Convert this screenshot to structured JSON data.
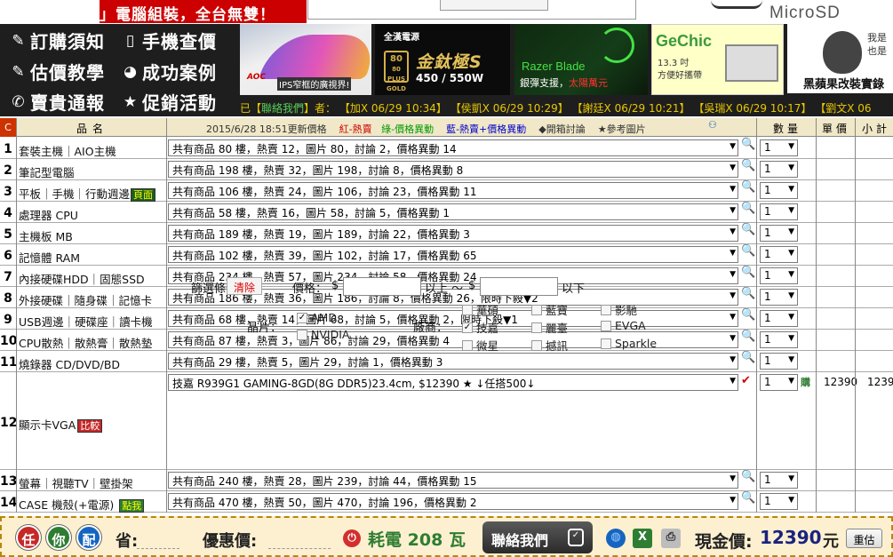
{
  "banner": {
    "slogan": "」電腦組裝，全台無雙！",
    "microsd": "MicroSD"
  },
  "menu": [
    {
      "icon": "wrench-icon",
      "glyph": "✎",
      "label": "訂購須知"
    },
    {
      "icon": "phone-icon",
      "glyph": "▯",
      "label": "手機查價"
    },
    {
      "icon": "edit-icon",
      "glyph": "✎",
      "label": "估價教學"
    },
    {
      "icon": "chat-icon",
      "glyph": "◕",
      "label": "成功案例"
    },
    {
      "icon": "telephone-icon",
      "glyph": "✆",
      "label": "賣貴通報"
    },
    {
      "icon": "star-icon",
      "glyph": "★",
      "label": "促銷活動"
    }
  ],
  "ads": {
    "aoc": {
      "brand": "AOC",
      "caption": "IPS窄框的廣視界!"
    },
    "psu": {
      "brand": "全漢電源",
      "badge": "80 PLUS GOLD",
      "name": "金鈦極S",
      "watt": "450 / 550W"
    },
    "razer": {
      "name": "Razer Blade",
      "sub_a": "銀彈支援，",
      "sub_b": "太陽萬元"
    },
    "gechic": {
      "brand": "GeChic",
      "l1": "13.3 吋",
      "l2": "方便好攜帶"
    },
    "apple": {
      "bubble1": "我是",
      "bubble2": "也是",
      "caption": "黑蘋果改裝實錄"
    }
  },
  "ticker": {
    "lead": "已【",
    "link": "聯絡我們",
    "after": "】者：",
    "items": "【加X 06/29 10:34】 【侯凱X 06/29 10:29】 【謝廷X 06/29 10:21】 【吳瑞X 06/29 10:17】 【劉文X 06"
  },
  "header": {
    "c": "C",
    "product_name": "品名",
    "updated": "2015/6/28 18:51更新價格",
    "legend_red": "紅-熱賣",
    "legend_green": "綠-價格異動",
    "legend_blue": "藍-熱賣+價格異動",
    "legend_discuss": "◆開箱討論",
    "legend_ref": "★參考圖片",
    "qty": "數量",
    "unit": "單價",
    "subtotal": "小計"
  },
  "rows": [
    {
      "n": "1",
      "cat": "套裝主機｜AIO主機",
      "summary": "共有商品 80 樓，熱賣 12，圖片 80，討論 2，價格異動 14",
      "qty": "1"
    },
    {
      "n": "2",
      "cat": "筆記型電腦",
      "summary": "共有商品 198 樓，熱賣 32，圖片 198，討論 8，價格異動 8",
      "qty": "1"
    },
    {
      "n": "3",
      "cat": "平板｜手機｜行動週邊",
      "tag": "頁面",
      "summary": "共有商品 106 樓，熱賣 24，圖片 106，討論 23，價格異動 11",
      "qty": "1"
    },
    {
      "n": "4",
      "cat": "處理器 CPU",
      "summary": "共有商品 58 樓，熱賣 16，圖片 58，討論 5，價格異動 1",
      "qty": "1"
    },
    {
      "n": "5",
      "cat": "主機板 MB",
      "summary": "共有商品 189 樓，熱賣 19，圖片 189，討論 22，價格異動 3",
      "qty": "1"
    },
    {
      "n": "6",
      "cat": "記憶體 RAM",
      "summary": "共有商品 102 樓，熱賣 39，圖片 102，討論 17，價格異動 65",
      "qty": "1"
    },
    {
      "n": "7",
      "cat": "內接硬碟HDD｜固態SSD",
      "summary": "共有商品 234 樓，熱賣 57，圖片 234，討論 58，價格異動 24",
      "qty": "1"
    },
    {
      "n": "8",
      "cat": "外接硬碟｜隨身碟｜記憶卡",
      "summary": "共有商品 186 樓，熱賣 36，圖片 186，討論 8，價格異動 26，限時下殺▼2",
      "qty": "1"
    },
    {
      "n": "9",
      "cat": "USB週邊｜硬碟座｜讀卡機",
      "summary": "共有商品 68 樓，熱賣 14，圖片 68，討論 5，價格異動 2，限時下殺▼1",
      "qty": "1"
    },
    {
      "n": "10",
      "cat": "CPU散熱｜散熱膏｜散熱墊",
      "summary": "共有商品 87 樓，熱賣 3，圖片 86，討論 29，價格異動 4",
      "qty": "1"
    },
    {
      "n": "11",
      "cat": "燒錄器 CD/DVD/BD",
      "summary": "共有商品 29 樓，熱賣 5，圖片 29，討論 1，價格異動 3",
      "qty": "1"
    }
  ],
  "vga": {
    "n": "12",
    "cat": "顯示卡VGA",
    "tag": "比較",
    "selected": "技嘉 R939G1 GAMING-8GD(8G DDR5)23.4cm, $12390 ★ ↓任搭500↓",
    "qty": "1",
    "buy": "購",
    "price": "12390",
    "subtotal": "1239",
    "filter_label": "篩選條件：",
    "clear": "清除",
    "price_label": "價格：",
    "currency": "$",
    "above": "以上 ～",
    "below": "以下",
    "chip_label": "晶片：",
    "chips": [
      {
        "name": "AMD",
        "checked": true
      },
      {
        "name": "NVIDIA",
        "checked": false
      }
    ],
    "vendor_label": "廠商：",
    "vendors": [
      {
        "name": "華碩",
        "checked": false
      },
      {
        "name": "技嘉",
        "checked": true
      },
      {
        "name": "微星",
        "checked": false
      },
      {
        "name": "藍寶",
        "checked": false
      },
      {
        "name": "麗臺",
        "checked": false
      },
      {
        "name": "撼訊",
        "checked": false
      },
      {
        "name": "影馳",
        "checked": false
      },
      {
        "name": "EVGA",
        "checked": false
      },
      {
        "name": "Sparkle",
        "checked": false
      }
    ]
  },
  "rows2": [
    {
      "n": "13",
      "cat": "螢幕｜視聽TV｜壁掛架",
      "summary": "共有商品 240 樓，熱賣 28，圖片 239，討論 44，價格異動 15",
      "qty": "1"
    },
    {
      "n": "14",
      "cat": "CASE 機殼(+電源)",
      "tag": "點我",
      "summary": "共有商品 470 樓，熱賣 50，圖片 470，討論 196，價格異動 2",
      "qty": "1"
    }
  ],
  "footer": {
    "b1": "任",
    "b2": "你",
    "b3": "配",
    "save_label": "省:",
    "discount_label": "優惠價:",
    "power_label": "耗電",
    "power_value": "208",
    "power_unit": "瓦",
    "contact": "聯絡我們",
    "cash_label": "現金價:",
    "cash_value": "12390",
    "cash_unit": "元",
    "reset": "重估"
  },
  "colors": {
    "header_red": "#cc0000",
    "dark_bar": "#1e1e1e",
    "green_text": "#2e7d32",
    "cash_blue": "#1a237e"
  }
}
